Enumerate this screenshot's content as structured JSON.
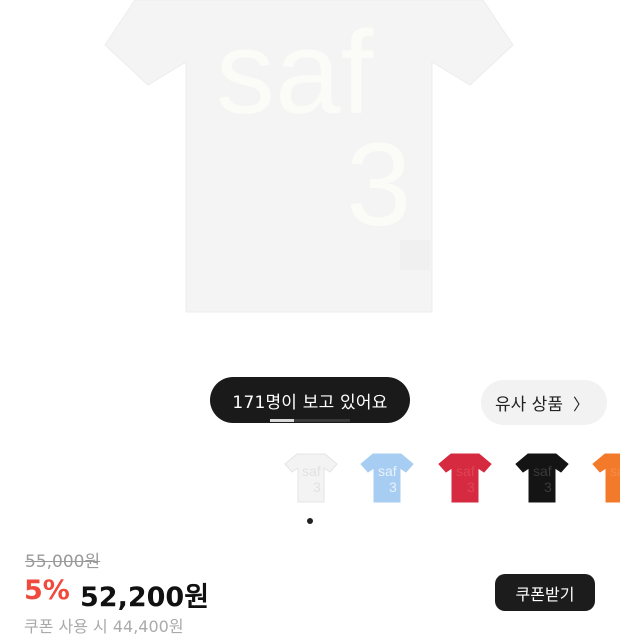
{
  "hero": {
    "shirt_print_word": "saf",
    "shirt_print_number": "3"
  },
  "viewers": {
    "label": "171명이 보고 있어요"
  },
  "similar": {
    "label": "유사 상품",
    "chevron_icon": "chevron-right-icon"
  },
  "image_progress": {
    "fraction": 0.3
  },
  "swatches": [
    {
      "color": "#f3f3f3",
      "print": "#e2e2e2"
    },
    {
      "color": "#a8cdf2",
      "print": "#e8f1fb"
    },
    {
      "color": "#d52a3f",
      "print": "#e04456"
    },
    {
      "color": "#141414",
      "print": "#3a3a3a"
    },
    {
      "color": "#f47a2b",
      "print": "#f48c46"
    }
  ],
  "pager": {
    "current": 1
  },
  "price": {
    "original": "55,000원",
    "discount": "5%",
    "sale": "52,200원",
    "coupon_label": "쿠폰받기",
    "coupon_note": "쿠폰 사용 시 44,400원"
  }
}
